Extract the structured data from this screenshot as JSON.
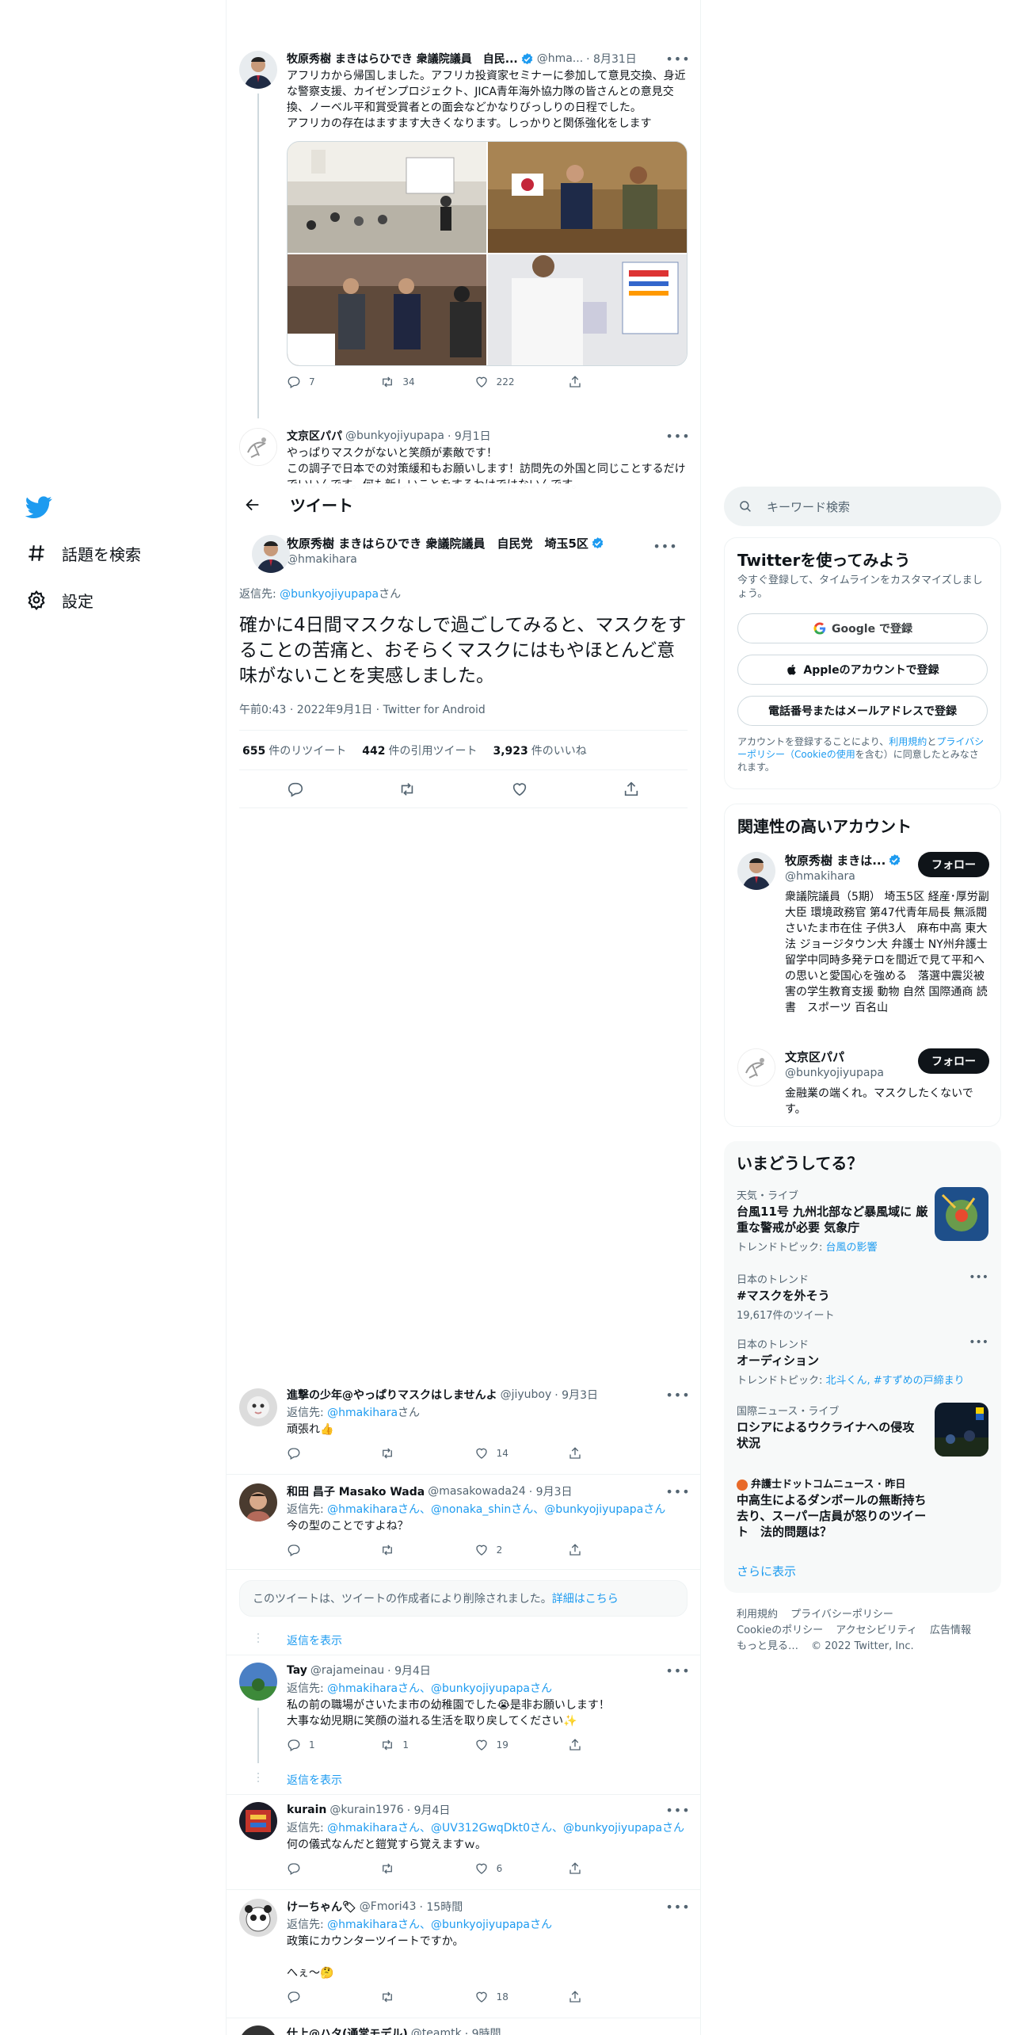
{
  "nav": {
    "explore_label": "話題を検索",
    "settings_label": "設定"
  },
  "header": {
    "title": "ツイート"
  },
  "prev_tweets": [
    {
      "name": "牧原秀樹 まきはらひでき 衆議院議員　自民...",
      "handle": "@hma...",
      "date": "· 8月31日",
      "text": "アフリカから帰国しました。アフリカ投資家セミナーに参加して意見交換、身近な警察支援、カイゼンプロジェクト、JICA青年海外協力隊の皆さんとの意見交換、ノーベル平和賞受賞者との面会などかなりびっしりの日程でした。\nアフリカの存在はますます大きくなります。しっかりと関係強化をします",
      "replies": "7",
      "retweets": "34",
      "likes": "222"
    },
    {
      "name": "文京区パパ",
      "handle": "@bunkyojiyupapa",
      "date": "· 9月1日",
      "text": "やっぱりマスクがないと笑顔が素敵です！\nこの調子で日本での対策緩和もお願いします！訪問先の外国と同じことするだけでいいんです。何も新しいことをするわけではないんです。"
    }
  ],
  "main_tweet": {
    "name": "牧原秀樹 まきはらひでき 衆議院議員　自民党　埼玉5区",
    "handle": "@hmakihara",
    "reply_prefix": "返信先: ",
    "reply_to": "@bunkyojiyupapa",
    "reply_suffix": "さん",
    "text": "確かに4日間マスクなしで過ごしてみると、マスクをすることの苦痛と、おそらくマスクにはもやほとんど意味がないことを実感しました。",
    "meta": "午前0:43 · 2022年9月1日 · Twitter for Android",
    "retweets": "655",
    "retweets_label": "件のリツイート",
    "quotes": "442",
    "quotes_label": "件の引用ツイート",
    "likes": "3,923",
    "likes_label": "件のいいね"
  },
  "replies": [
    {
      "name": "進撃の少年@やっぱりマスクはしませんよ",
      "handle": "@jiyuboy",
      "date": "· 9月3日",
      "reply_prefix": "返信先: ",
      "reply_to": "@hmakihara",
      "reply_suffix": "さん",
      "text": "頑張れ👍",
      "replies": "",
      "retweets": "",
      "likes": "14"
    },
    {
      "name": "和田 昌子 Masako Wada",
      "handle": "@masakowada24",
      "date": "· 9月3日",
      "reply_prefix": "返信先: ",
      "reply_to": "@hmakiharaさん、@nonaka_shinさん、@bunkyojiyupapaさん",
      "text": "今の型のことですよね？",
      "replies": "",
      "retweets": "",
      "likes": "2"
    },
    {
      "name": "Tay",
      "handle": "@rajameinau",
      "date": "· 9月4日",
      "reply_prefix": "返信先: ",
      "reply_to": "@hmakiharaさん、@bunkyojiyupapaさん",
      "text": "私の前の職場がさいたま市の幼稚園でした😭是非お願いします！\n大事な幼児期に笑顔の溢れる生活を取り戻してください✨",
      "replies": "1",
      "retweets": "1",
      "likes": "19"
    },
    {
      "name": "kurain",
      "handle": "@kurain1976",
      "date": "· 9月4日",
      "reply_prefix": "返信先: ",
      "reply_to": "@hmakiharaさん、@UV312GwqDkt0さん、@bunkyojiyupapaさん",
      "text": "何の儀式なんだと鎧覚すら覚えますｗ。",
      "replies": "",
      "retweets": "",
      "likes": "6"
    },
    {
      "name": "けーちゃん🏷",
      "handle": "@Fmori43",
      "date": "· 15時間",
      "reply_prefix": "返信先: ",
      "reply_to": "@hmakiharaさん、@bunkyojiyupapaさん",
      "text": "政策にカウンターツイートですか。\n\nへぇ〜🤔",
      "replies": "",
      "retweets": "",
      "likes": "18"
    }
  ],
  "last_partial": {
    "name": "仕上@ハタ(通常モデル)",
    "handle": "@teamtk",
    "date": "· 9時間"
  },
  "deleted_notice": {
    "text": "このツイートは、ツイートの作成者により削除されました。",
    "link": "詳細はこちら"
  },
  "show_replies_label": "返信を表示",
  "search": {
    "placeholder": "キーワード検索"
  },
  "signup": {
    "title": "Twitterを使ってみよう",
    "subtitle": "今すぐ登録して、タイムラインをカスタマイズしましょう。",
    "google": "Google で登録",
    "apple": "Appleのアカウントで登録",
    "phone": "電話番号またはメールアドレスで登録",
    "terms_prefix": "アカウントを登録することにより、",
    "terms_link1": "利用規約",
    "terms_mid": "と",
    "terms_link2": "プライバシーポリシー（Cookieの使用",
    "terms_suffix": "を含む）に同意したとみなされます。"
  },
  "related": {
    "title": "関連性の高いアカウント",
    "follow_label": "フォロー",
    "accounts": [
      {
        "name": "牧原秀樹 まきは...",
        "handle": "@hmakihara",
        "bio": "衆議院議員（5期） 埼玉5区 経産･厚労副大臣 環境政務官 第47代青年局長 無派閥 さいたま市在住 子供3人　麻布中高 東大法 ジョージタウン大 弁護士 NY州弁護士 留学中同時多発テロを間近で見て平和への思いと愛国心を強める　落選中震災被害の学生教育支援 動物 自然 国際通商 読書　スポーツ 百名山"
      },
      {
        "name": "文京区パパ",
        "handle": "@bunkyojiyupapa",
        "bio": "金融業の端くれ。マスクしたくないです。"
      }
    ]
  },
  "trends": {
    "title": "いまどうしてる？",
    "items": [
      {
        "category": "天気・ライブ",
        "title": "台風11号 九州北部など暴風域に 厳重な警戒が必要 気象庁",
        "sub_prefix": "トレンドトピック: ",
        "sub_link": "台風の影響"
      },
      {
        "category": "日本のトレンド",
        "title": "#マスクを外そう",
        "sub": "19,617件のツイート"
      },
      {
        "category": "日本のトレンド",
        "title": "オーディション",
        "sub_prefix": "トレンドトピック: ",
        "sub_link": "北斗くん, #すずめの戸締まり"
      },
      {
        "category": "国際ニュース・ライブ",
        "title": "ロシアによるウクライナへの侵攻状況"
      },
      {
        "category": "弁護士ドットコムニュース · 昨日",
        "title": "中高生によるダンボールの無断持ち去り、スーパー店員が怒りのツイート　法的問題は？"
      }
    ],
    "show_more": "さらに表示"
  },
  "footer": {
    "links": [
      "利用規約",
      "プライバシーポリシー",
      "Cookieのポリシー",
      "アクセシビリティ",
      "広告情報",
      "もっと見る…",
      "© 2022 Twitter, Inc."
    ]
  },
  "colors": {
    "accent": "#1d9bf0",
    "text": "#0f1419",
    "muted": "#536471"
  }
}
